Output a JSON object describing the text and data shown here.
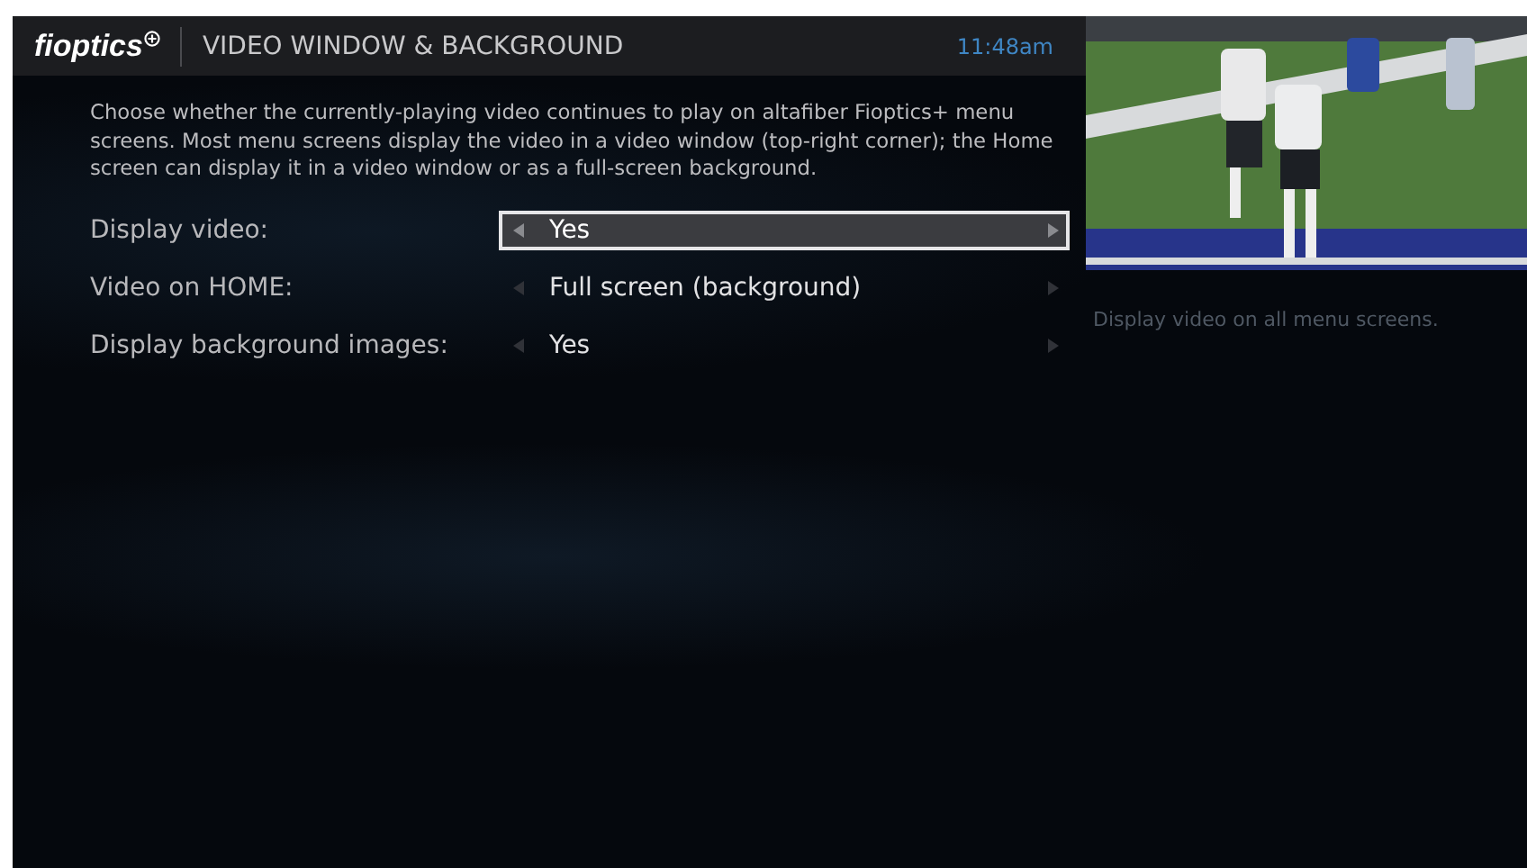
{
  "header": {
    "logo": "fioptics",
    "title": "VIDEO WINDOW & BACKGROUND",
    "time": "11:48am"
  },
  "description": "Choose whether the currently-playing video continues to play on altafiber Fioptics+ menu screens. Most menu screens display the video in a video window (top-right corner); the Home screen can display it in a video window or as a full-screen background.",
  "settings": [
    {
      "label": "Display video:",
      "value": "Yes",
      "selected": true
    },
    {
      "label": "Video on HOME:",
      "value": "Full screen (background)",
      "selected": false
    },
    {
      "label": "Display background images:",
      "value": "Yes",
      "selected": false
    }
  ],
  "hint": "Display video on all menu screens."
}
